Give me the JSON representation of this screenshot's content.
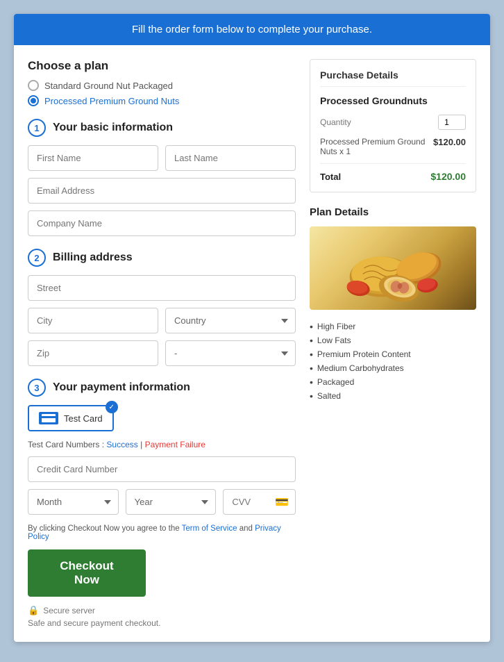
{
  "banner": {
    "text": "Fill the order form below to complete your purchase."
  },
  "left": {
    "choose_plan": {
      "title": "Choose a plan",
      "options": [
        {
          "label": "Standard Ground Nut Packaged",
          "selected": false
        },
        {
          "label": "Processed Premium Ground Nuts",
          "selected": true
        }
      ]
    },
    "section1": {
      "number": "1",
      "title": "Your basic information",
      "first_name_placeholder": "First Name",
      "last_name_placeholder": "Last Name",
      "email_placeholder": "Email Address",
      "company_placeholder": "Company Name"
    },
    "section2": {
      "number": "2",
      "title": "Billing address",
      "street_placeholder": "Street",
      "city_placeholder": "City",
      "country_placeholder": "Country",
      "zip_placeholder": "Zip",
      "state_placeholder": "-"
    },
    "section3": {
      "number": "3",
      "title": "Your payment information",
      "card_label": "Test Card",
      "test_card_label": "Test Card Numbers :",
      "success_label": "Success",
      "separator": "|",
      "failure_label": "Payment Failure",
      "cc_placeholder": "Credit Card Number",
      "month_placeholder": "Month",
      "year_placeholder": "Year",
      "cvv_placeholder": "CVV",
      "terms_text": "By clicking Checkout Now you agree to the ",
      "terms_link": "Term of Service",
      "terms_and": " and ",
      "privacy_link": "Privacy Policy",
      "checkout_label": "Checkout Now",
      "secure_server": "Secure server",
      "secure_desc": "Safe and secure payment checkout."
    }
  },
  "right": {
    "purchase_details": {
      "title": "Purchase Details",
      "product_title": "Processed Groundnuts",
      "qty_label": "Quantity",
      "qty_value": "1",
      "price_desc": "Processed Premium Ground Nuts x 1",
      "price_amount": "$120.00",
      "total_label": "Total",
      "total_amount": "$120.00"
    },
    "plan_details": {
      "title": "Plan Details",
      "features": [
        "High Fiber",
        "Low Fats",
        "Premium Protein Content",
        "Medium Carbohydrates",
        "Packaged",
        "Salted"
      ]
    }
  }
}
